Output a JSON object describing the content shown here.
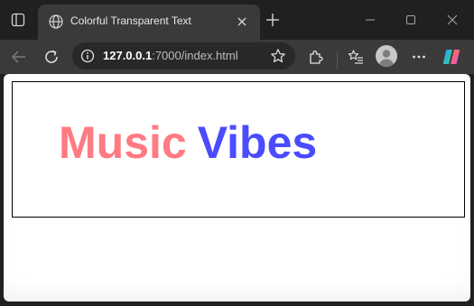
{
  "browser": {
    "tab": {
      "title": "Colorful Transparent Text"
    },
    "url": {
      "host": "127.0.0.1",
      "rest": ":7000/index.html"
    }
  },
  "page": {
    "words": [
      {
        "text": "Music",
        "color": "#ff7b83"
      },
      {
        "text": "Vibes",
        "color": "#4b4bff"
      }
    ]
  },
  "icons": {
    "tab_actions": "tab-actions-icon",
    "favicon": "globe-icon",
    "tab_close": "close-icon",
    "new_tab": "plus-icon",
    "minimize": "minimize-icon",
    "maximize": "maximize-icon",
    "close": "close-icon",
    "back": "back-arrow-icon",
    "reload": "reload-icon",
    "site_info": "info-icon",
    "favorite": "star-icon",
    "extensions": "puzzle-icon",
    "favorites": "favorites-list-icon",
    "profile": "avatar",
    "menu": "more-icon",
    "copilot": "copilot-icon"
  }
}
